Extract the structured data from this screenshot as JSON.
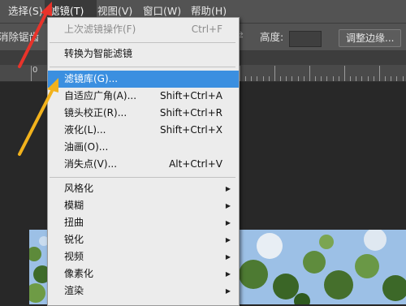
{
  "menubar": {
    "items": [
      {
        "label": "选择(S)"
      },
      {
        "label": "滤镜(T)"
      },
      {
        "label": "视图(V)"
      },
      {
        "label": "窗口(W)"
      },
      {
        "label": "帮助(H)"
      }
    ]
  },
  "options": {
    "erase_label": "消除锯齿",
    "height_label": "高度:",
    "refine_button": "调整边缘..."
  },
  "ruler": {
    "labels": [
      "0"
    ]
  },
  "filter_menu": {
    "items": [
      {
        "label": "上次滤镜操作(F)",
        "shortcut": "Ctrl+F",
        "disabled": true
      },
      {
        "label": "转换为智能滤镜"
      },
      {
        "label": "滤镜库(G)...",
        "highlighted": true
      },
      {
        "label": "自适应广角(A)...",
        "shortcut": "Shift+Ctrl+A"
      },
      {
        "label": "镜头校正(R)...",
        "shortcut": "Shift+Ctrl+R"
      },
      {
        "label": "液化(L)...",
        "shortcut": "Shift+Ctrl+X"
      },
      {
        "label": "油画(O)..."
      },
      {
        "label": "消失点(V)...",
        "shortcut": "Alt+Ctrl+V"
      },
      {
        "label": "风格化"
      },
      {
        "label": "模糊"
      },
      {
        "label": "扭曲"
      },
      {
        "label": "锐化"
      },
      {
        "label": "视频"
      },
      {
        "label": "像素化"
      },
      {
        "label": "渲染"
      }
    ]
  },
  "colors": {
    "accent_highlight": "#3b8fe0",
    "arrow_red": "#e8332a",
    "arrow_yellow": "#f2b21c"
  },
  "icons": {
    "submenu": "chevron-right-icon",
    "swap": "swap-icon"
  }
}
